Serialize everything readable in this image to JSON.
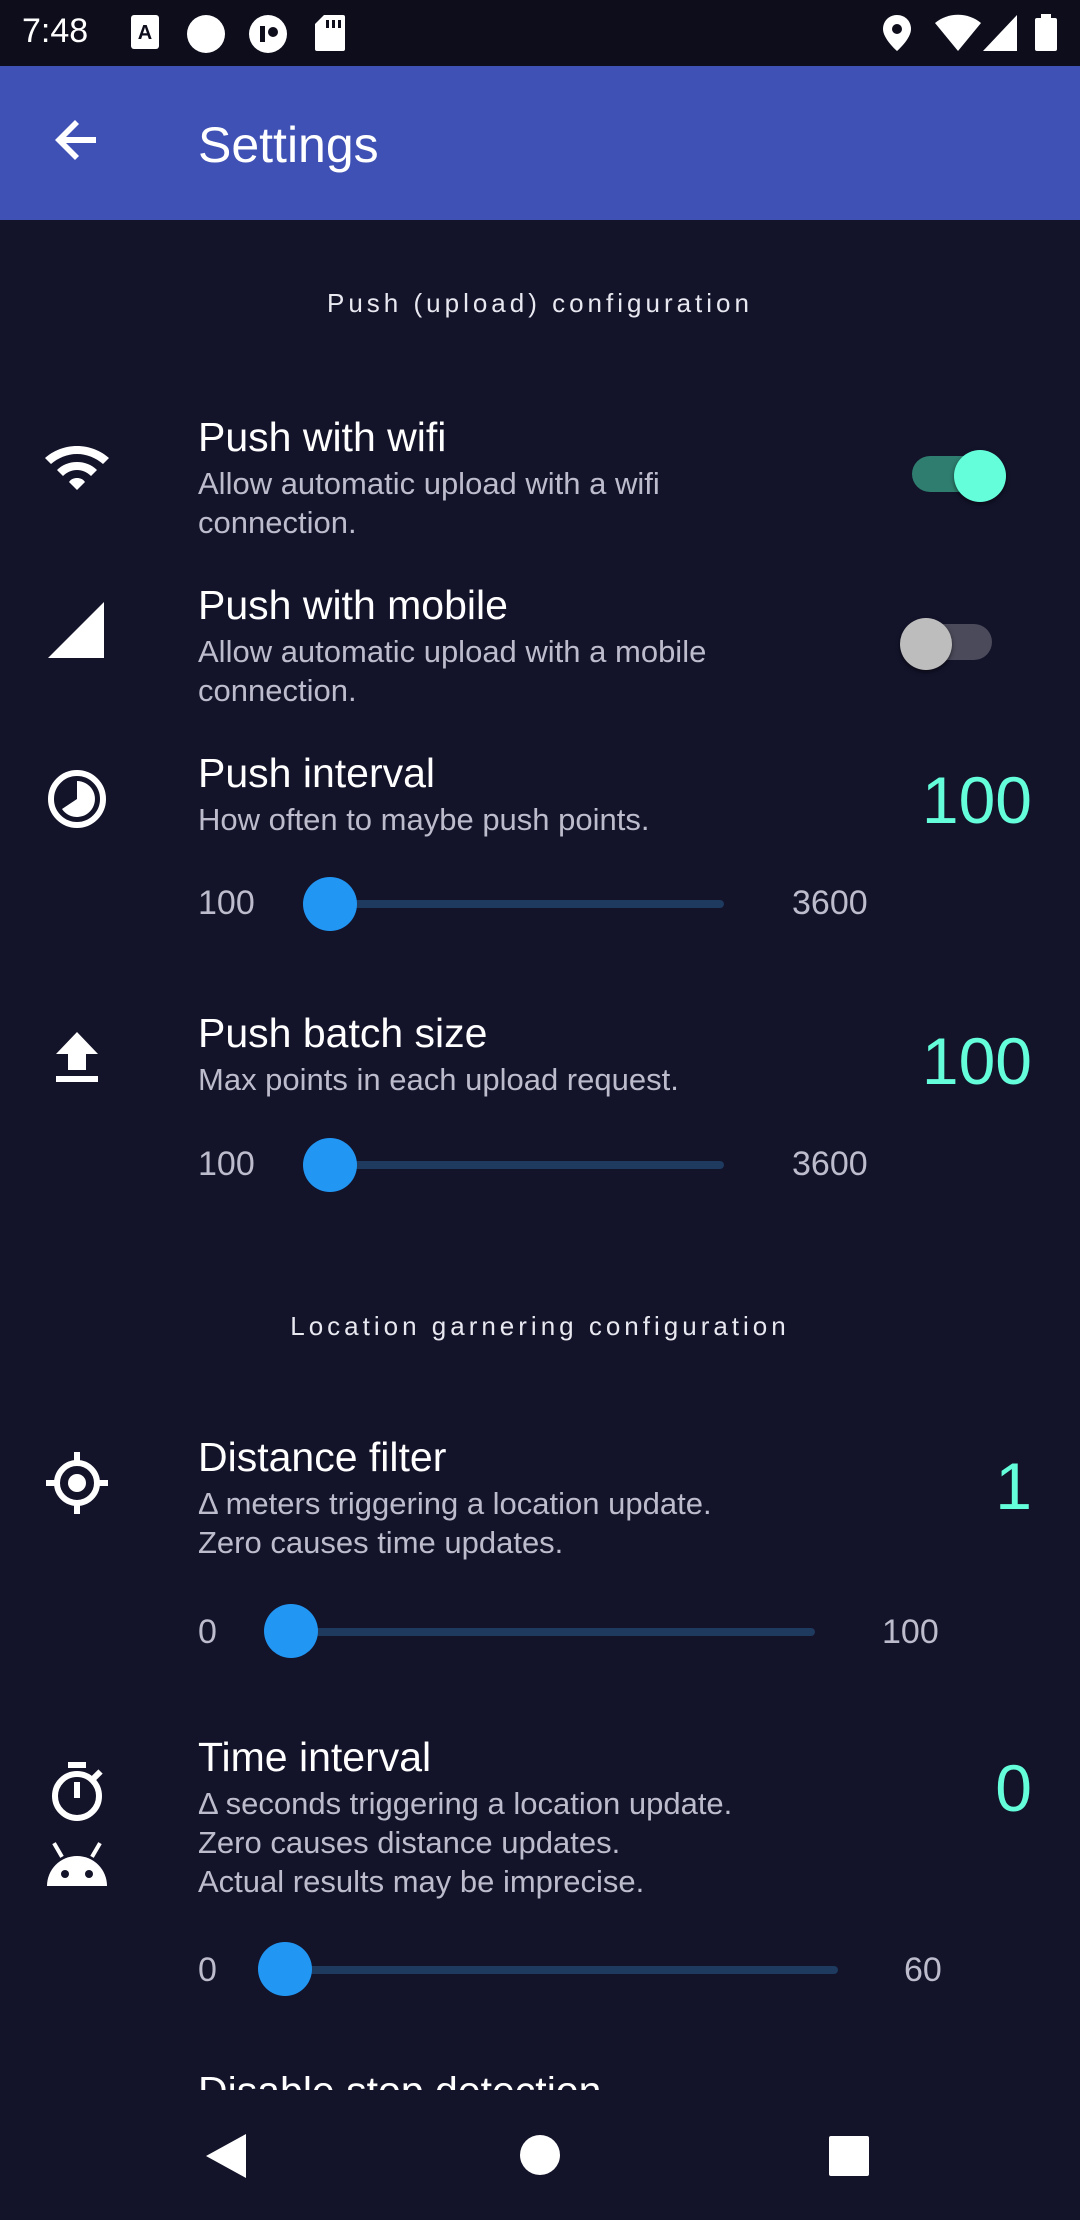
{
  "status_bar": {
    "time": "7:48",
    "left_icons": [
      "font-notification-icon",
      "circle-notification-icon",
      "app-notification-icon",
      "sd-card-icon"
    ],
    "right_icons": [
      "location-icon",
      "wifi-icon",
      "signal-icon",
      "battery-icon"
    ]
  },
  "app_bar": {
    "title": "Settings",
    "back_icon": "arrow-back-icon",
    "color": "#3f51b5"
  },
  "sections": {
    "push": {
      "header": "Push (upload) configuration"
    },
    "location": {
      "header": "Location garnering configuration"
    }
  },
  "settings": {
    "push_wifi": {
      "icon": "wifi-icon",
      "title": "Push with wifi",
      "description": "Allow automatic upload with a wifi\nconnection.",
      "enabled": true
    },
    "push_mobile": {
      "icon": "cell-signal-icon",
      "title": "Push with mobile",
      "description": "Allow automatic upload with a mobile\nconnection.",
      "enabled": false
    },
    "push_interval": {
      "icon": "timelapse-icon",
      "title": "Push interval",
      "description": "How often to maybe push points.",
      "value": "100",
      "min": "100",
      "max": "3600"
    },
    "push_batch": {
      "icon": "upload-icon",
      "title": "Push batch size",
      "description": "Max points in each upload request.",
      "value": "100",
      "min": "100",
      "max": "3600"
    },
    "distance_filter": {
      "icon": "gps-fixed-icon",
      "title": "Distance filter",
      "description": "Δ meters triggering a location update.\nZero causes time updates.",
      "value": "1",
      "min": "0",
      "max": "100"
    },
    "time_interval": {
      "icon": "timer-icon",
      "secondary_icon": "android-icon",
      "title": "Time interval",
      "description": "Δ seconds triggering a location update.\nZero causes distance updates.\nActual results may be imprecise.",
      "value": "0",
      "min": "0",
      "max": "60"
    },
    "next_partial": {
      "title": "Disable stop detection"
    }
  },
  "nav_bar": {
    "icons": [
      "back-triangle-icon",
      "home-circle-icon",
      "recents-square-icon"
    ]
  },
  "colors": {
    "background": "#13132a",
    "accent_value": "#64ffda",
    "slider": "#2196f3",
    "switch_on_track": "#2e7d6e",
    "switch_on_thumb": "#64ffda",
    "switch_off_thumb": "#bdbdbd"
  }
}
